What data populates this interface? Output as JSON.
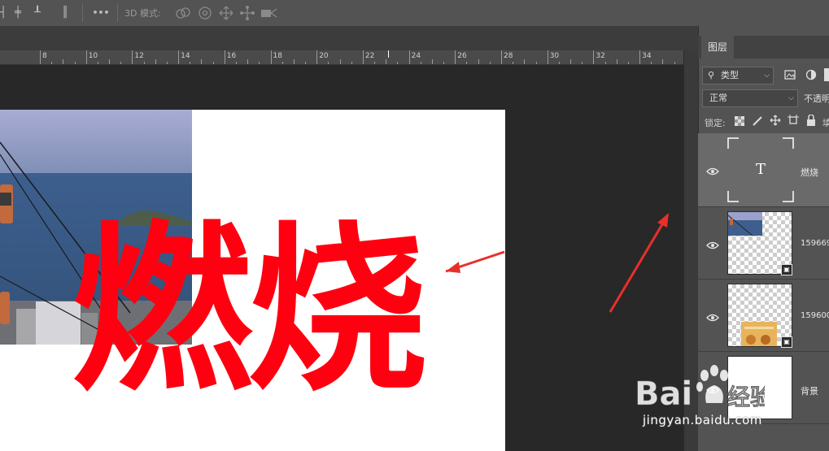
{
  "toolbar": {
    "mode_label": "3D 模式:",
    "more_label": "•••"
  },
  "ruler": {
    "labels": [
      "8",
      "10",
      "12",
      "14",
      "16",
      "18",
      "20",
      "22",
      "24",
      "26",
      "28",
      "30",
      "32",
      "34"
    ]
  },
  "canvas": {
    "text": "燃烧",
    "text_color": "#ff0010"
  },
  "panel": {
    "tab_label": "图层",
    "filter_label": "类型",
    "blend_mode": "正常",
    "opacity_label": "不透明",
    "lock_label": "锁定:",
    "fill_label": "填"
  },
  "layers": [
    {
      "name": "燃烧",
      "kind": "text",
      "thumb_glyph": "T",
      "selected": true
    },
    {
      "name": "159669",
      "kind": "smart",
      "selected": false
    },
    {
      "name": "159600",
      "kind": "smart",
      "selected": false
    },
    {
      "name": "背景",
      "kind": "background",
      "selected": false
    }
  ],
  "watermark": {
    "brand_text": "Bai 经验",
    "url": "jingyan.baidu.com"
  }
}
